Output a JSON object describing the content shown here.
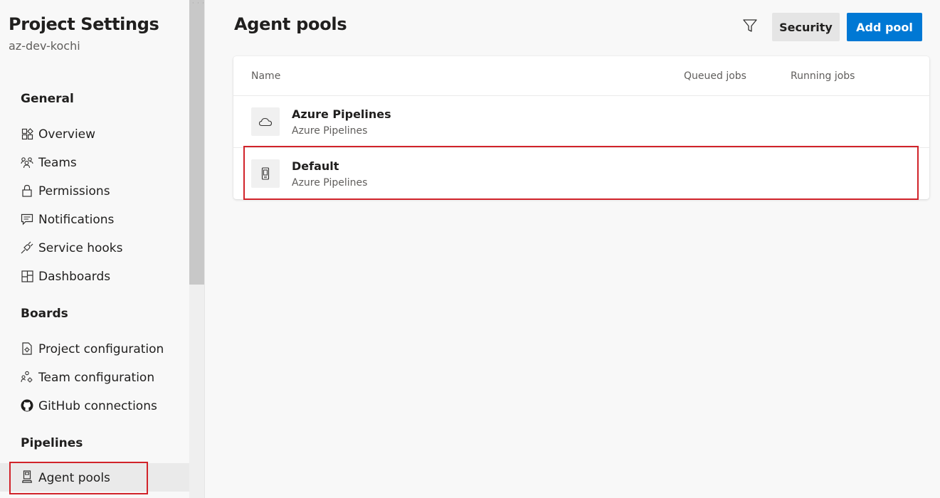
{
  "sidebar": {
    "title": "Project Settings",
    "subtitle": "az-dev-kochi",
    "sections": {
      "general": {
        "header": "General",
        "items": [
          "Overview",
          "Teams",
          "Permissions",
          "Notifications",
          "Service hooks",
          "Dashboards"
        ]
      },
      "boards": {
        "header": "Boards",
        "items": [
          "Project configuration",
          "Team configuration",
          "GitHub connections"
        ]
      },
      "pipelines": {
        "header": "Pipelines",
        "items": [
          "Agent pools"
        ],
        "selected": "Agent pools"
      }
    }
  },
  "main": {
    "title": "Agent pools",
    "toolbar": {
      "filter_icon": "filter-icon",
      "security_label": "Security",
      "add_pool_label": "Add pool"
    },
    "table": {
      "columns": [
        "Name",
        "Queued jobs",
        "Running jobs"
      ],
      "rows": [
        {
          "name": "Azure Pipelines",
          "subtitle": "Azure Pipelines",
          "icon": "cloud-icon"
        },
        {
          "name": "Default",
          "subtitle": "Azure Pipelines",
          "icon": "agent-device-icon"
        }
      ]
    }
  },
  "colors": {
    "primary_button": "#0078d4",
    "highlight": "#d1232a",
    "selected_nav_bg": "#eaeaea"
  }
}
